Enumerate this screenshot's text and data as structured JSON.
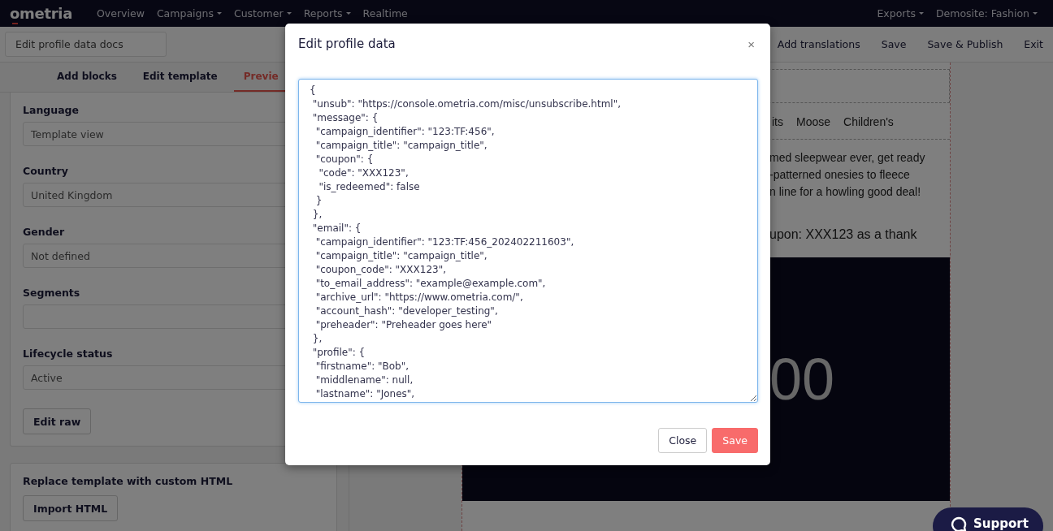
{
  "nav": {
    "logo": "ometria",
    "items": [
      {
        "label": "Overview",
        "dropdown": false
      },
      {
        "label": "Campaigns",
        "dropdown": true
      },
      {
        "label": "Customer",
        "dropdown": true
      },
      {
        "label": "Reports",
        "dropdown": true
      },
      {
        "label": "Realtime",
        "dropdown": false
      }
    ],
    "right_items": [
      {
        "label": "Exports",
        "dropdown": true
      },
      {
        "label": "Demosite: Fashion",
        "dropdown": true
      }
    ]
  },
  "toolbar": {
    "docs_button": "Edit profile data docs",
    "actions": [
      "Add translations",
      "Save",
      "Save & Publish",
      "Exit"
    ]
  },
  "tabs": [
    {
      "label": "Add blocks",
      "selected": false
    },
    {
      "label": "Edit template",
      "selected": false
    },
    {
      "label": "Previe",
      "selected": true
    }
  ],
  "profile_form": {
    "fields": [
      {
        "label": "Language",
        "value": "Template view"
      },
      {
        "label": "Country",
        "value": "United Kingdom"
      },
      {
        "label": "Gender",
        "value": "Not defined"
      },
      {
        "label": "Segments"
      },
      {
        "label": "Lifecycle status",
        "value": "Active"
      }
    ],
    "button": "Edit raw"
  },
  "custom_html": {
    "title": "Replace template with custom HTML",
    "button": "Import HTML"
  },
  "email_preview": {
    "menu": [
      "its",
      "Moose",
      "Children's"
    ],
    "paragraph_lines": [
      "med sleepwear ever, get ready",
      "-patterned onesies to fleece",
      "n line for a howling good deal!"
    ],
    "coupon_line": "upon: XXX123 as a thank",
    "banner_text": "00"
  },
  "modal": {
    "title": "Edit profile data",
    "close": "×",
    "editor_text": "{\n \"unsub\": \"https://console.ometria.com/misc/unsubscribe.html\",\n \"message\": {\n  \"campaign_identifier\": \"123:TF:456\",\n  \"campaign_title\": \"campaign_title\",\n  \"coupon\": {\n   \"code\": \"XXX123\",\n   \"is_redeemed\": false\n  }\n },\n \"email\": {\n  \"campaign_identifier\": \"123:TF:456_202402211603\",\n  \"campaign_title\": \"campaign_title\",\n  \"coupon_code\": \"XXX123\",\n  \"to_email_address\": \"example@example.com\",\n  \"archive_url\": \"https://www.ometria.com/\",\n  \"account_hash\": \"developer_testing\",\n  \"preheader\": \"Preheader goes here\"\n },\n \"profile\": {\n  \"firstname\": \"Bob\",\n  \"middlename\": null,\n  \"lastname\": \"Jones\",",
    "buttons": [
      {
        "label": "Close",
        "kind": "default"
      },
      {
        "label": "Save",
        "kind": "primary"
      }
    ]
  },
  "support": {
    "label": "Support"
  }
}
